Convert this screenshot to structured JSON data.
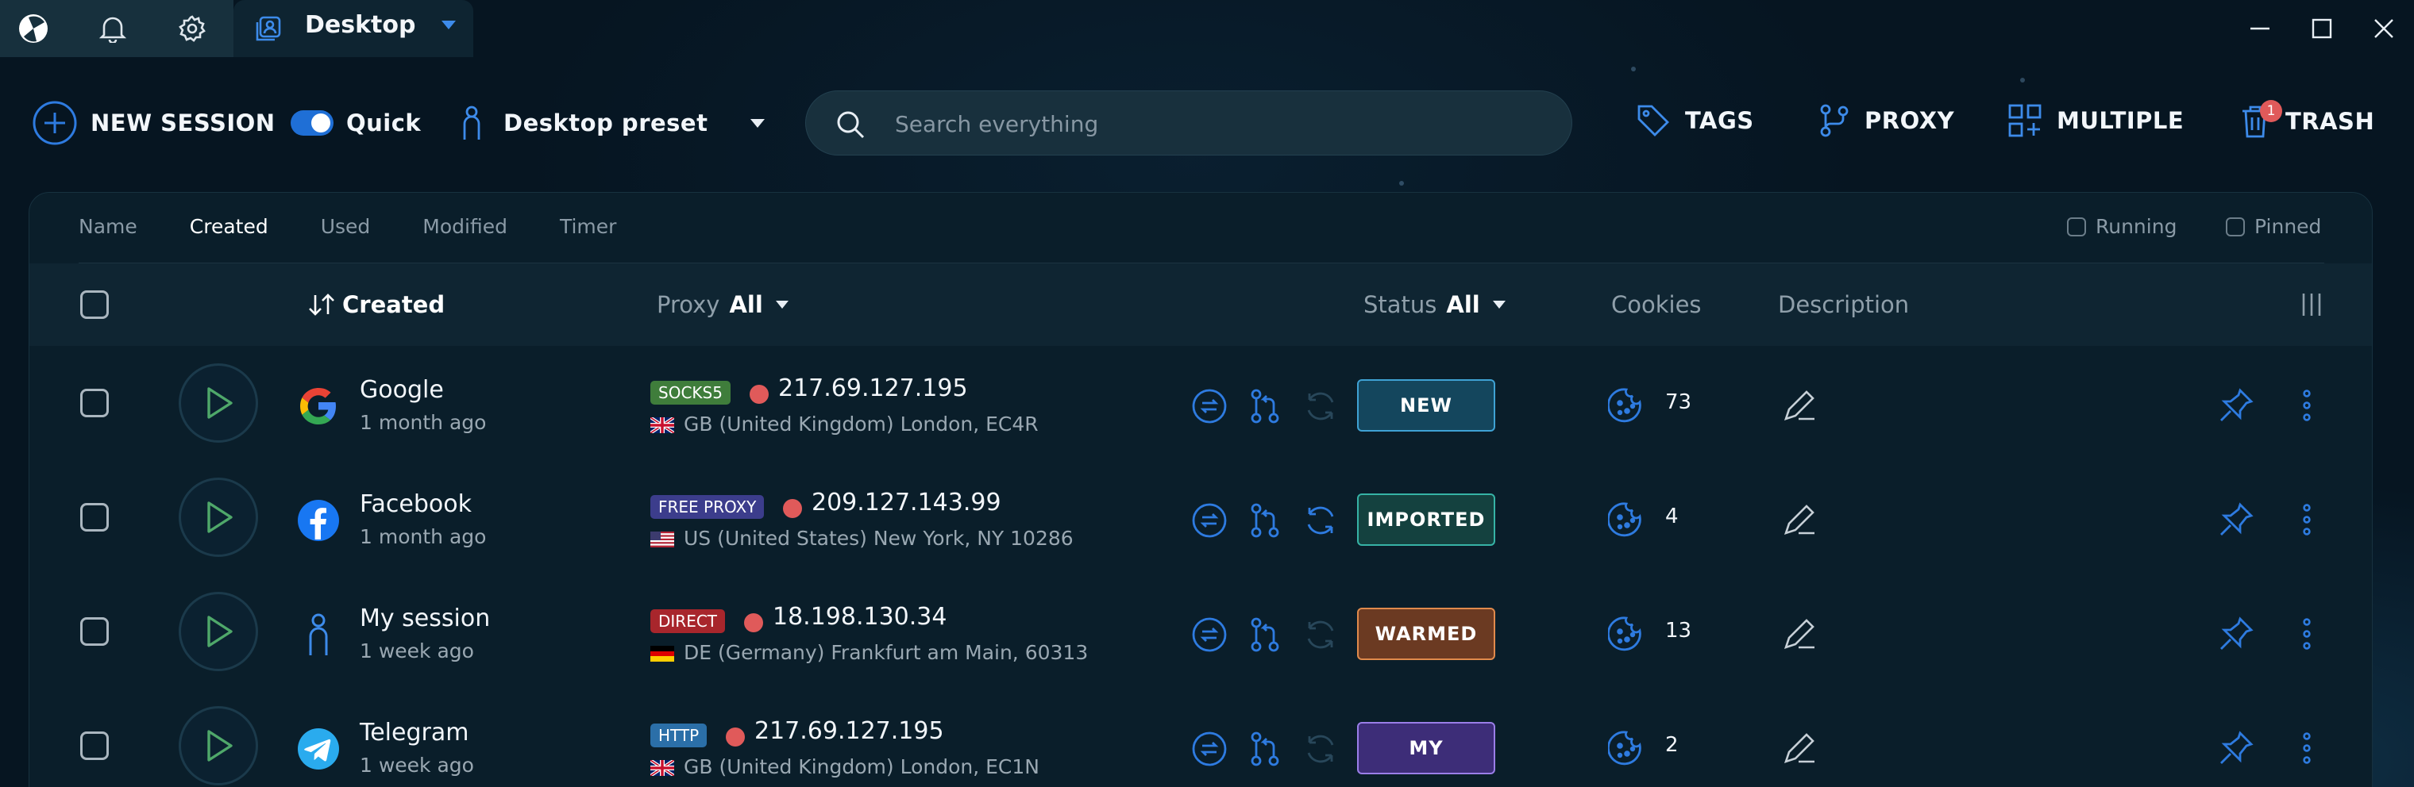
{
  "window": {
    "tab_title": "Desktop"
  },
  "toolbar": {
    "new_session": "NEW SESSION",
    "quick_label": "Quick",
    "preset_label": "Desktop preset",
    "search_placeholder": "Search everything",
    "tags": "TAGS",
    "proxy": "PROXY",
    "multiple": "MULTIPLE",
    "trash": "TRASH",
    "trash_count": "1"
  },
  "sort_tabs": [
    "Name",
    "Created",
    "Used",
    "Modified",
    "Timer"
  ],
  "active_sort_tab": "Created",
  "filters": {
    "running": "Running",
    "pinned": "Pinned"
  },
  "columns": {
    "created": "Created",
    "proxy": "Proxy",
    "proxy_filter": "All",
    "status": "Status",
    "status_filter": "All",
    "cookies": "Cookies",
    "description": "Description"
  },
  "sessions": [
    {
      "name": "Google",
      "age": "1 month ago",
      "logo": "google-logo",
      "proxy_type": "SOCKS5",
      "proxy_type_color": "#3f7d3b",
      "ip": "217.69.127.195",
      "flag": "uk-flag",
      "location": "GB (United Kingdom) London, EC4R",
      "status": "NEW",
      "status_bg": "#14465d",
      "status_border": "#3fa2d4",
      "cookies": "73"
    },
    {
      "name": "Facebook",
      "age": "1 month ago",
      "logo": "facebook-logo",
      "proxy_type": "FREE PROXY",
      "proxy_type_color": "#3c3d8c",
      "ip": "209.127.143.99",
      "flag": "us-flag",
      "location": "US (United States) New York, NY 10286",
      "status": "IMPORTED",
      "status_bg": "#14413f",
      "status_border": "#36b3a6",
      "cookies": "4"
    },
    {
      "name": "My session",
      "age": "1 week ago",
      "logo": "person-icon",
      "proxy_type": "DIRECT",
      "proxy_type_color": "#a8262c",
      "ip": "18.198.130.34",
      "flag": "de-flag",
      "location": "DE (Germany) Frankfurt am Main, 60313",
      "status": "WARMED",
      "status_bg": "#6b3a22",
      "status_border": "#e08a4c",
      "cookies": "13"
    },
    {
      "name": "Telegram",
      "age": "1 week ago",
      "logo": "telegram-logo",
      "proxy_type": "HTTP",
      "proxy_type_color": "#2b6fa8",
      "ip": "217.69.127.195",
      "flag": "uk-flag",
      "location": "GB (United Kingdom) London, EC1N",
      "status": "MY",
      "status_bg": "#3d2d78",
      "status_border": "#9a7ee8",
      "cookies": "2"
    }
  ],
  "colors": {
    "accent": "#2e7be0",
    "play_green": "#4fa86a"
  }
}
